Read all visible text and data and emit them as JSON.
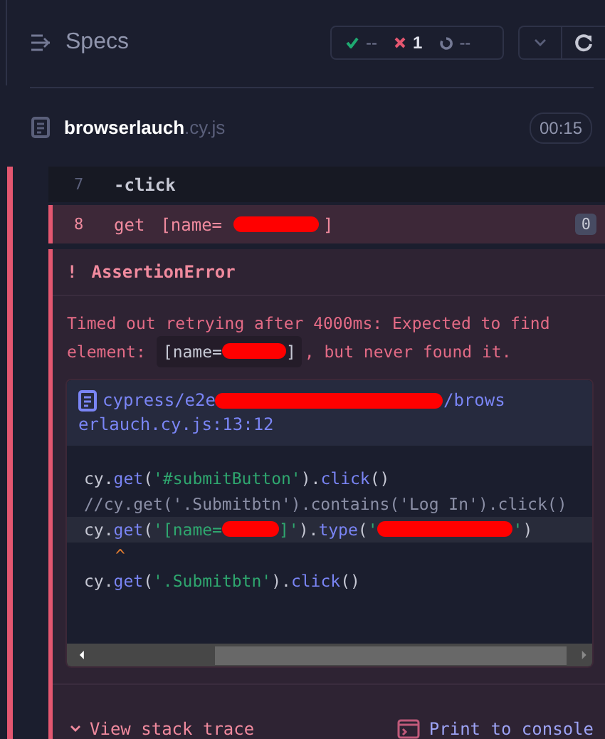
{
  "header": {
    "title": "Specs",
    "stats": [
      {
        "kind": "passed",
        "count": "--"
      },
      {
        "kind": "failed",
        "count": "1"
      },
      {
        "kind": "pending",
        "count": "--"
      }
    ]
  },
  "spec": {
    "name": "browserlauch",
    "ext": ".cy.js",
    "duration": "00:15"
  },
  "commands": [
    {
      "number": "7",
      "kind": "child",
      "parts": [
        {
          "kind": "text",
          "text": "-click"
        }
      ],
      "failed": false
    },
    {
      "number": "8",
      "kind": "parent",
      "parts": [
        {
          "kind": "text",
          "text": "get"
        },
        {
          "kind": "text",
          "text": "[name="
        },
        {
          "kind": "redaction"
        },
        {
          "kind": "text",
          "text": "]"
        }
      ],
      "failed": true,
      "badge": "0"
    }
  ],
  "error": {
    "mark": "!",
    "title": "AssertionError",
    "message": [
      [
        {
          "kind": "text",
          "text": "Timed out retrying after 4000ms: Expected to find"
        }
      ],
      [
        {
          "kind": "text",
          "text": "element:"
        },
        {
          "kind": "code",
          "parts": [
            {
              "kind": "text",
              "text": "[name="
            },
            {
              "kind": "redaction"
            },
            {
              "kind": "text",
              "text": "]"
            }
          ]
        },
        {
          "kind": "text",
          "text": ", but never found it."
        }
      ]
    ],
    "frame": {
      "path": [
        [
          {
            "kind": "text",
            "text": "cypress/e2e"
          },
          {
            "kind": "redaction"
          },
          {
            "kind": "text",
            "text": "/brows"
          }
        ],
        [
          {
            "kind": "text",
            "text": "erlauch.cy.js:13:12"
          }
        ]
      ],
      "lines": [
        {
          "highlighted": false,
          "tokens": [
            {
              "kind": "plain",
              "text": "cy."
            },
            {
              "kind": "func",
              "text": "get"
            },
            {
              "kind": "plain",
              "text": "("
            },
            {
              "kind": "string",
              "text": "'#submitButton'"
            },
            {
              "kind": "plain",
              "text": ")."
            },
            {
              "kind": "func",
              "text": "click"
            },
            {
              "kind": "plain",
              "text": "()"
            }
          ]
        },
        {
          "highlighted": false,
          "tokens": [
            {
              "kind": "comment",
              "text": "//cy.get('.Submitbtn').contains('Log In').click()"
            }
          ]
        },
        {
          "highlighted": true,
          "tokens": [
            {
              "kind": "plain",
              "text": "cy."
            },
            {
              "kind": "func",
              "text": "get"
            },
            {
              "kind": "plain",
              "text": "("
            },
            {
              "kind": "string",
              "text": "'[name="
            },
            {
              "kind": "redaction"
            },
            {
              "kind": "string",
              "text": "]'"
            },
            {
              "kind": "plain",
              "text": ")."
            },
            {
              "kind": "func",
              "text": "type"
            },
            {
              "kind": "plain",
              "text": "("
            },
            {
              "kind": "string",
              "text": "'"
            },
            {
              "kind": "redaction"
            },
            {
              "kind": "string",
              "text": "'"
            },
            {
              "kind": "plain",
              "text": ")"
            }
          ]
        },
        {
          "highlighted": false,
          "tokens": [
            {
              "kind": "caret",
              "text": "^"
            }
          ]
        },
        {
          "highlighted": false,
          "tokens": [
            {
              "kind": "plain",
              "text": "cy."
            },
            {
              "kind": "func",
              "text": "get"
            },
            {
              "kind": "plain",
              "text": "("
            },
            {
              "kind": "string",
              "text": "'.Submitbtn'"
            },
            {
              "kind": "plain",
              "text": ")."
            },
            {
              "kind": "func",
              "text": "click"
            },
            {
              "kind": "plain",
              "text": "()"
            }
          ]
        }
      ]
    },
    "actions": [
      {
        "kind": "stack",
        "label": "View stack trace"
      },
      {
        "kind": "console",
        "label": "Print to console"
      }
    ]
  }
}
